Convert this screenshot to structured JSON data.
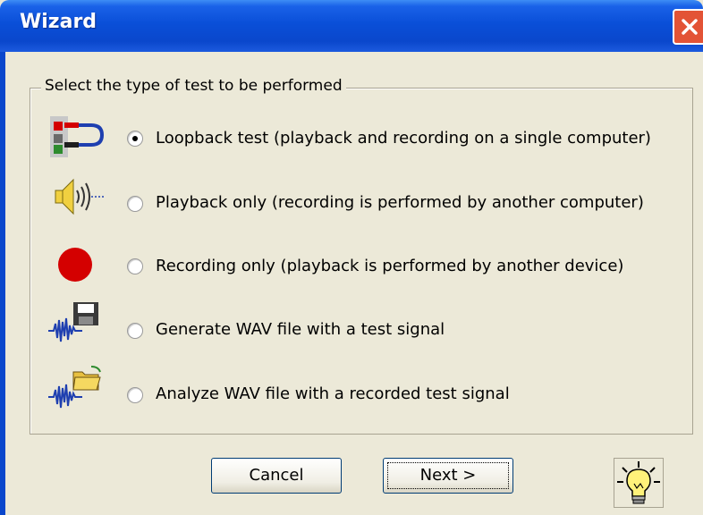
{
  "window": {
    "title": "Wizard"
  },
  "group": {
    "label": "Select the type of test to be performed"
  },
  "options": [
    {
      "label": "Loopback test (playback and recording on a single computer)",
      "selected": true,
      "icon": "loopback-cable-icon"
    },
    {
      "label": "Playback only (recording is performed by another computer)",
      "selected": false,
      "icon": "speaker-icon"
    },
    {
      "label": "Recording only (playback is performed by another device)",
      "selected": false,
      "icon": "record-icon"
    },
    {
      "label": "Generate WAV file with a test signal",
      "selected": false,
      "icon": "save-wav-icon"
    },
    {
      "label": "Analyze WAV file with a recorded test signal",
      "selected": false,
      "icon": "open-wav-icon"
    }
  ],
  "buttons": {
    "cancel": "Cancel",
    "next": "Next >"
  },
  "colors": {
    "titlebar": "#0A47CC",
    "close": "#E35336",
    "dialog": "#ECE9D8",
    "record": "#D40000"
  }
}
